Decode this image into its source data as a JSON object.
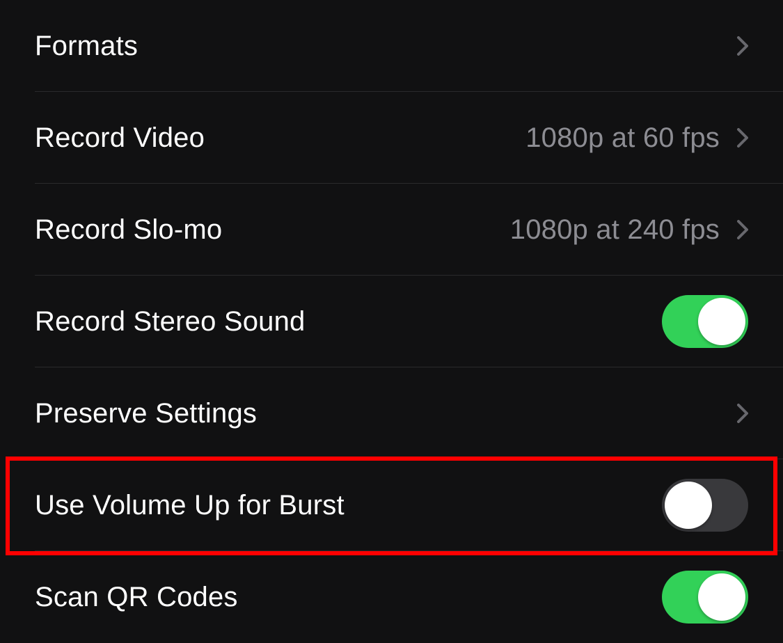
{
  "rows": [
    {
      "label": "Formats",
      "type": "nav",
      "value": ""
    },
    {
      "label": "Record Video",
      "type": "nav",
      "value": "1080p at 60 fps"
    },
    {
      "label": "Record Slo-mo",
      "type": "nav",
      "value": "1080p at 240 fps"
    },
    {
      "label": "Record Stereo Sound",
      "type": "toggle",
      "on": true
    },
    {
      "label": "Preserve Settings",
      "type": "nav",
      "value": ""
    },
    {
      "label": "Use Volume Up for Burst",
      "type": "toggle",
      "on": false
    },
    {
      "label": "Scan QR Codes",
      "type": "toggle",
      "on": true
    }
  ],
  "highlighted_index": 5,
  "colors": {
    "toggle_on": "#32d158",
    "toggle_off": "#39393c",
    "highlight": "#ff0000"
  }
}
